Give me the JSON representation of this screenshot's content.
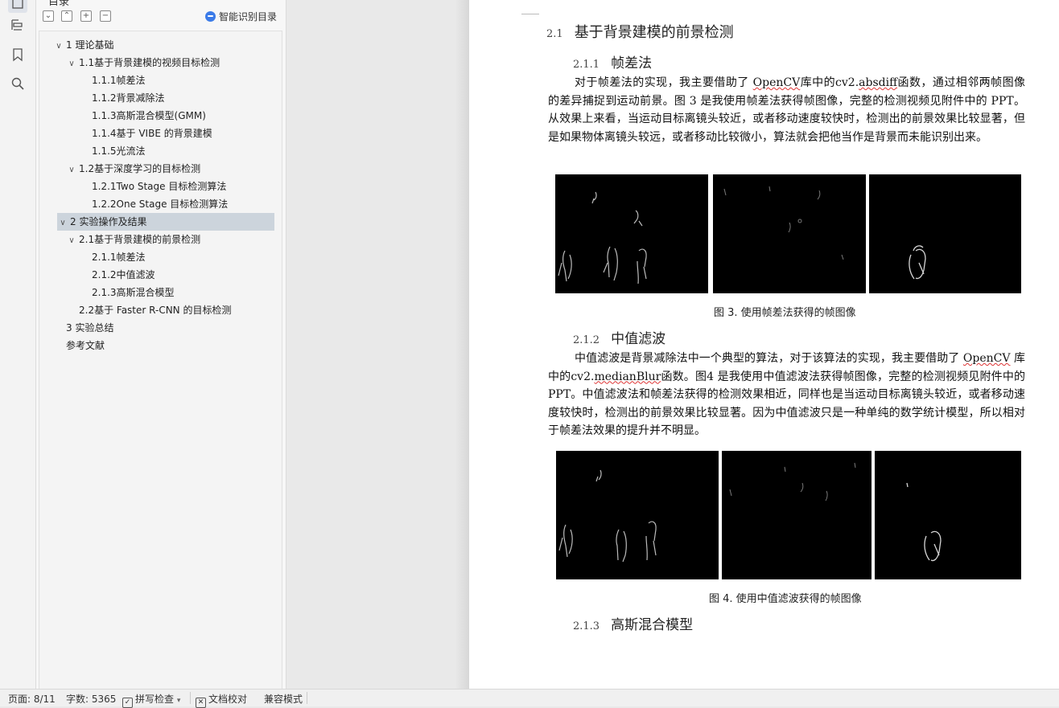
{
  "nav_panel": {
    "title": "目录",
    "smart_toc_label": "智能识别目录",
    "toolbar_symbols": {
      "collapse": "⌄",
      "expand": "⌃",
      "add": "+",
      "remove": "−"
    },
    "tree": [
      {
        "label": "1 理论基础",
        "level": 0,
        "caret": "∨"
      },
      {
        "label": "1.1基于背景建模的视频目标检测",
        "level": 1,
        "caret": "∨"
      },
      {
        "label": "1.1.1帧差法",
        "level": 2,
        "caret": ""
      },
      {
        "label": "1.1.2背景减除法",
        "level": 2,
        "caret": ""
      },
      {
        "label": "1.1.3高斯混合模型(GMM)",
        "level": 2,
        "caret": ""
      },
      {
        "label": "1.1.4基于 VIBE 的背景建模",
        "level": 2,
        "caret": ""
      },
      {
        "label": "1.1.5光流法",
        "level": 2,
        "caret": ""
      },
      {
        "label": "1.2基于深度学习的目标检测",
        "level": 1,
        "caret": "∨"
      },
      {
        "label": "1.2.1Two Stage 目标检测算法",
        "level": 2,
        "caret": ""
      },
      {
        "label": "1.2.2One Stage 目标检测算法",
        "level": 2,
        "caret": ""
      },
      {
        "label": "2 实验操作及结果",
        "level": 0,
        "caret": "∨",
        "selected": true
      },
      {
        "label": "2.1基于背景建模的前景检测",
        "level": 1,
        "caret": "∨"
      },
      {
        "label": "2.1.1帧差法",
        "level": 2,
        "caret": ""
      },
      {
        "label": "2.1.2中值滤波",
        "level": 2,
        "caret": ""
      },
      {
        "label": "2.1.3高斯混合模型",
        "level": 2,
        "caret": ""
      },
      {
        "label": "2.2基于 Faster R-CNN 的目标检测",
        "level": 1,
        "caret": ""
      },
      {
        "label": "3 实验总结",
        "level": 0,
        "caret": ""
      },
      {
        "label": "参考文献",
        "level": 0,
        "caret": ""
      }
    ]
  },
  "document": {
    "section": {
      "num": "2.1",
      "title": "基于背景建模的前景检测"
    },
    "sub1": {
      "num": "2.1.1",
      "title": "帧差法"
    },
    "para1": {
      "a": "对于帧差法的实现，我主要借助了 ",
      "b": "OpenCV",
      "c": "库中的cv2.",
      "d": "absdiff",
      "e": "函数，通过相邻两帧图像的差异捕捉到运动前景。图 3 是我使用帧差法获得帧图像，完整的检测视频见附件中的 PPT。从效果上来看，当运动目标离镜头较近，或者移动速度较快时，检测出的前景效果比较显著，但是如果物体离镜头较远，或者移动比较微小，算法就会把他当作是背景而未能识别出来。"
    },
    "fig3_caption": "图 3. 使用帧差法获得的帧图像",
    "sub2": {
      "num": "2.1.2",
      "title": "中值滤波"
    },
    "para2": {
      "a": "中值滤波是背景减除法中一个典型的算法，对于该算法的实现，我主要借助了 ",
      "b": "OpenCV",
      "c": " 库中的cv2.",
      "d": "medianBlur",
      "e": "函数。图4 是我使用中值滤波法获得帧图像，完整的检测视频见附件中的 PPT。中值滤波法和帧差法获得的检测效果相近，同样也是当运动目标离镜头较近，或者移动速度较快时，检测出的前景效果比较显著。因为中值滤波只是一种单纯的数学统计模型，所以相对于帧差法效果的提升并不明显。"
    },
    "fig4_caption": "图 4. 使用中值滤波获得的帧图像",
    "sub3": {
      "num": "2.1.3",
      "title": "高斯混合模型"
    }
  },
  "status_bar": {
    "page": "页面: 8/11",
    "words": "字数: 5365",
    "spell": "拼写检查",
    "proof": "文档校对",
    "compat": "兼容模式",
    "check_symbol": "✓",
    "proof_symbol": "✕",
    "dropdown_symbol": "▾"
  }
}
